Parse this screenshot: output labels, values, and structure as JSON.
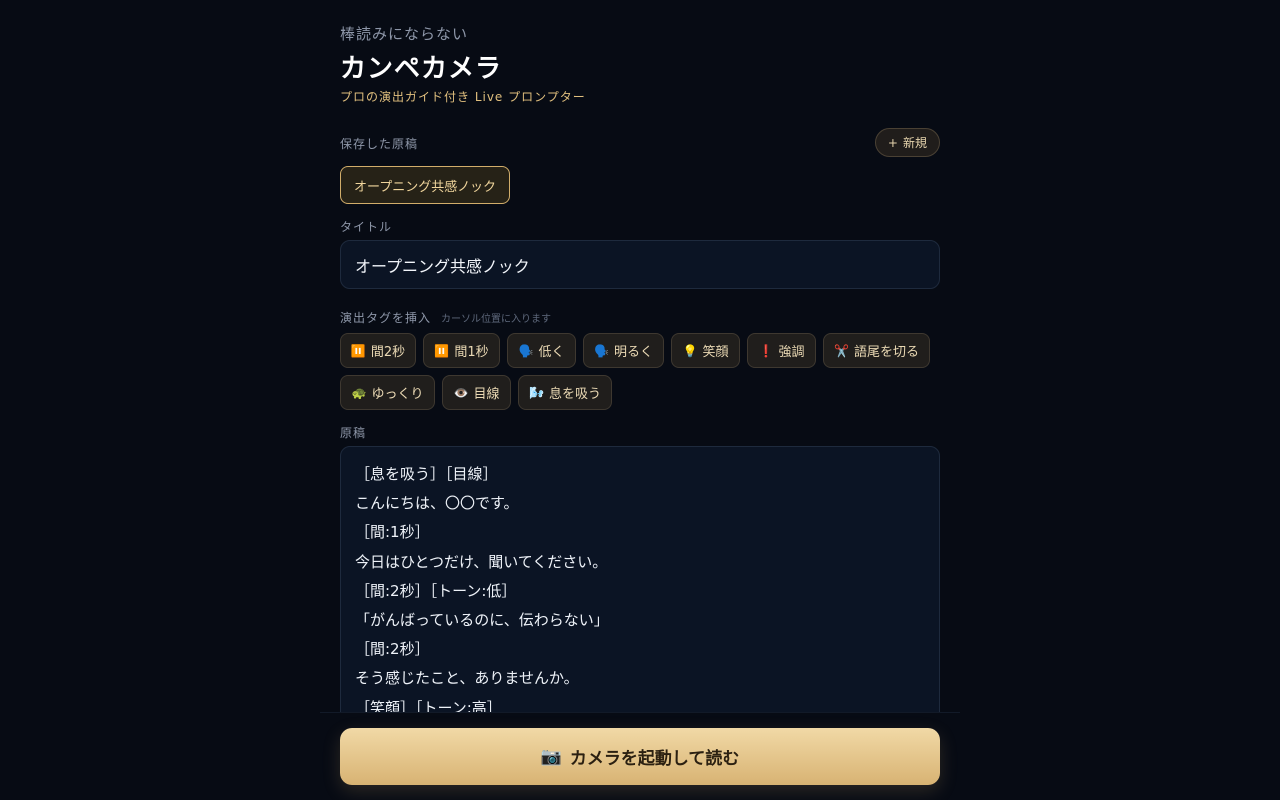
{
  "header": {
    "subtitle": "棒読みにならない",
    "title": "カンペカメラ",
    "tagline": "プロの演出ガイド付き Live プロンプター"
  },
  "saved": {
    "label": "保存した原稿",
    "new_button_icon": "plus-icon",
    "new_button_icon_glyph": "+",
    "new_button_label": "新規",
    "items": [
      {
        "label": "オープニング共感ノック"
      }
    ]
  },
  "title_field": {
    "label": "タイトル",
    "value": "オープニング共感ノック"
  },
  "tags": {
    "label": "演出タグを挿入",
    "hint": "カーソル位置に入ります",
    "buttons": [
      {
        "icon": "pause-icon",
        "glyph": "⏸️",
        "label": "間2秒"
      },
      {
        "icon": "pause-icon",
        "glyph": "⏸️",
        "label": "間1秒"
      },
      {
        "icon": "speaking-head-icon",
        "glyph": "🗣️",
        "label": "低く"
      },
      {
        "icon": "speaking-head-icon",
        "glyph": "🗣️",
        "label": "明るく"
      },
      {
        "icon": "light-bulb-icon",
        "glyph": "💡",
        "label": "笑顔"
      },
      {
        "icon": "exclamation-icon",
        "glyph": "❗",
        "label": "強調"
      },
      {
        "icon": "scissors-icon",
        "glyph": "✂️",
        "label": "語尾を切る"
      },
      {
        "icon": "turtle-icon",
        "glyph": "🐢",
        "label": "ゆっくり"
      },
      {
        "icon": "eye-icon",
        "glyph": "👁️",
        "label": "目線"
      },
      {
        "icon": "wind-icon",
        "glyph": "🌬️",
        "label": "息を吸う"
      }
    ]
  },
  "script": {
    "label": "原稿",
    "lines": [
      "［息を吸う］［目線］",
      "こんにちは、〇〇です。",
      "［間:1秒］",
      "今日はひとつだけ、聞いてください。",
      "［間:2秒］［トーン:低］",
      "「がんばっているのに、伝わらない」",
      "［間:2秒］",
      "そう感じたこと、ありませんか。",
      "［笑顔］［トーン:高］"
    ]
  },
  "action": {
    "camera_icon": "camera-icon",
    "camera_glyph": "📷",
    "camera_label": "カメラを起動して読む"
  },
  "colors": {
    "background": "#070b14",
    "accent": "#d8b373",
    "field_background": "#0b1424"
  }
}
